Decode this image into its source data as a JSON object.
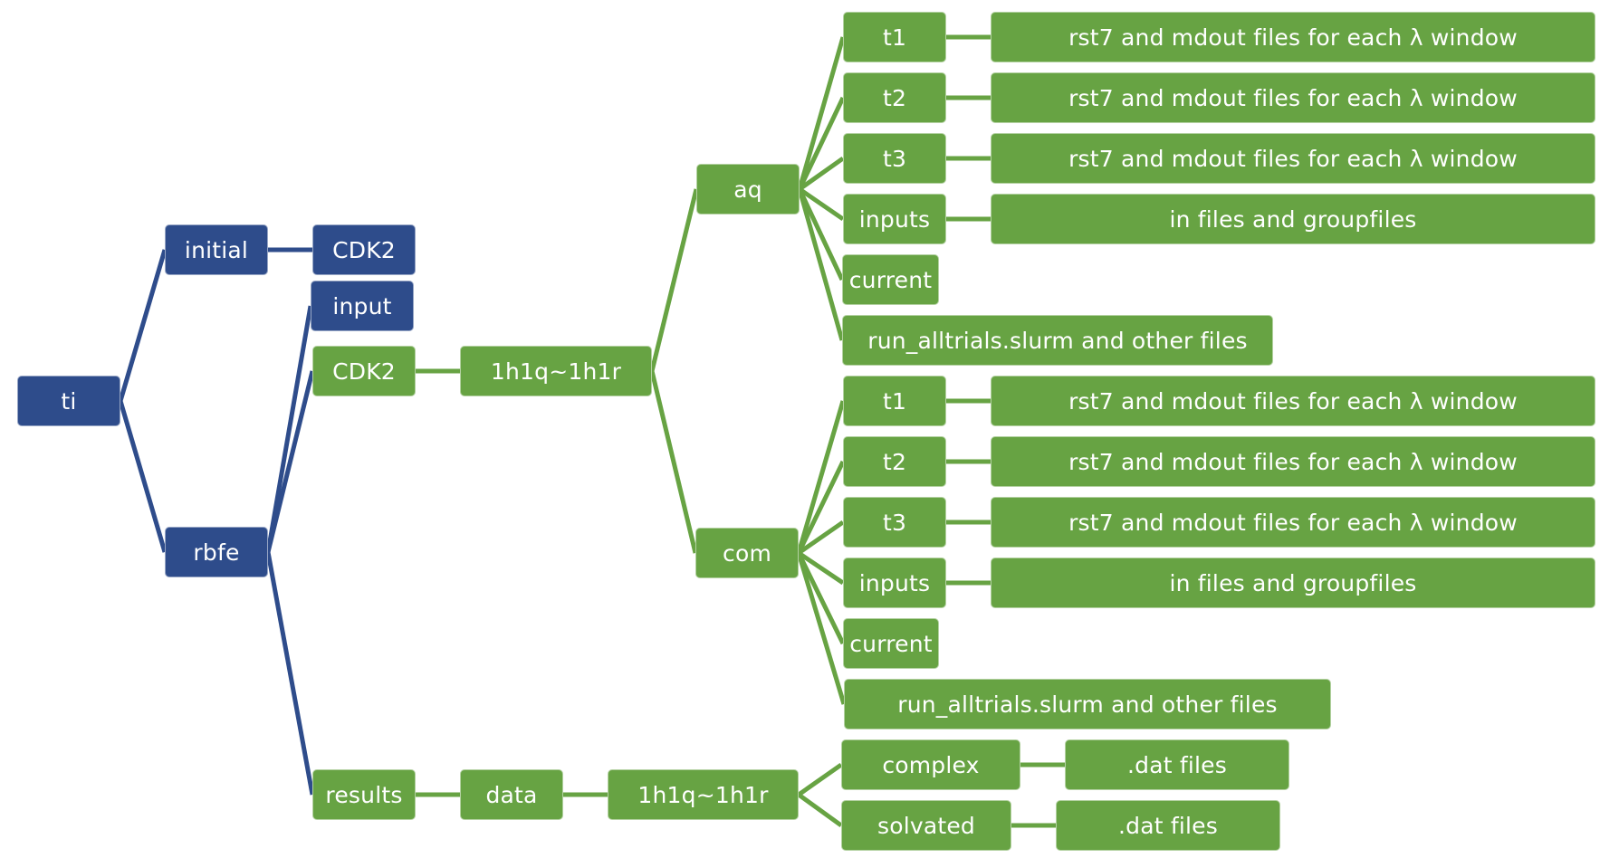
{
  "colors": {
    "blue": "#2e4c8b",
    "green": "#67a343",
    "background": "#ffffff"
  },
  "nodes": {
    "ti": "ti",
    "initial": "initial",
    "initial_cdk2": "CDK2",
    "rbfe": "rbfe",
    "rbfe_input": "input",
    "rbfe_cdk2": "CDK2",
    "pair": "1h1q~1h1r",
    "aq": "aq",
    "aq_t1": "t1",
    "aq_t1_desc": "rst7 and mdout files for each λ window",
    "aq_t2": "t2",
    "aq_t2_desc": "rst7 and mdout files for each λ window",
    "aq_t3": "t3",
    "aq_t3_desc": "rst7 and mdout files for each λ window",
    "aq_inputs": "inputs",
    "aq_inputs_desc": "in files and groupfiles",
    "aq_current": "current",
    "aq_run": "run_alltrials.slurm and other files",
    "com": "com",
    "com_t1": "t1",
    "com_t1_desc": "rst7 and mdout files for each λ window",
    "com_t2": "t2",
    "com_t2_desc": "rst7 and mdout files for each λ window",
    "com_t3": "t3",
    "com_t3_desc": "rst7 and mdout files for each λ window",
    "com_inputs": "inputs",
    "com_inputs_desc": "in files and groupfiles",
    "com_current": "current",
    "com_run": "run_alltrials.slurm and other files",
    "results": "results",
    "data": "data",
    "results_pair": "1h1q~1h1r",
    "complex": "complex",
    "complex_desc": ".dat files",
    "solvated": "solvated",
    "solvated_desc": ".dat files"
  },
  "edges": [
    [
      "ti",
      "initial"
    ],
    [
      "ti",
      "rbfe"
    ],
    [
      "initial",
      "initial_cdk2"
    ],
    [
      "rbfe",
      "rbfe_input"
    ],
    [
      "rbfe",
      "rbfe_cdk2"
    ],
    [
      "rbfe",
      "results"
    ],
    [
      "rbfe_cdk2",
      "pair"
    ],
    [
      "pair",
      "aq"
    ],
    [
      "pair",
      "com"
    ],
    [
      "aq",
      "aq_t1"
    ],
    [
      "aq",
      "aq_t2"
    ],
    [
      "aq",
      "aq_t3"
    ],
    [
      "aq",
      "aq_inputs"
    ],
    [
      "aq",
      "aq_current"
    ],
    [
      "aq",
      "aq_run"
    ],
    [
      "aq_t1",
      "aq_t1_desc"
    ],
    [
      "aq_t2",
      "aq_t2_desc"
    ],
    [
      "aq_t3",
      "aq_t3_desc"
    ],
    [
      "aq_inputs",
      "aq_inputs_desc"
    ],
    [
      "com",
      "com_t1"
    ],
    [
      "com",
      "com_t2"
    ],
    [
      "com",
      "com_t3"
    ],
    [
      "com",
      "com_inputs"
    ],
    [
      "com",
      "com_current"
    ],
    [
      "com",
      "com_run"
    ],
    [
      "com_t1",
      "com_t1_desc"
    ],
    [
      "com_t2",
      "com_t2_desc"
    ],
    [
      "com_t3",
      "com_t3_desc"
    ],
    [
      "com_inputs",
      "com_inputs_desc"
    ],
    [
      "results",
      "data"
    ],
    [
      "data",
      "results_pair"
    ],
    [
      "results_pair",
      "complex"
    ],
    [
      "results_pair",
      "solvated"
    ],
    [
      "complex",
      "complex_desc"
    ],
    [
      "solvated",
      "solvated_desc"
    ]
  ]
}
